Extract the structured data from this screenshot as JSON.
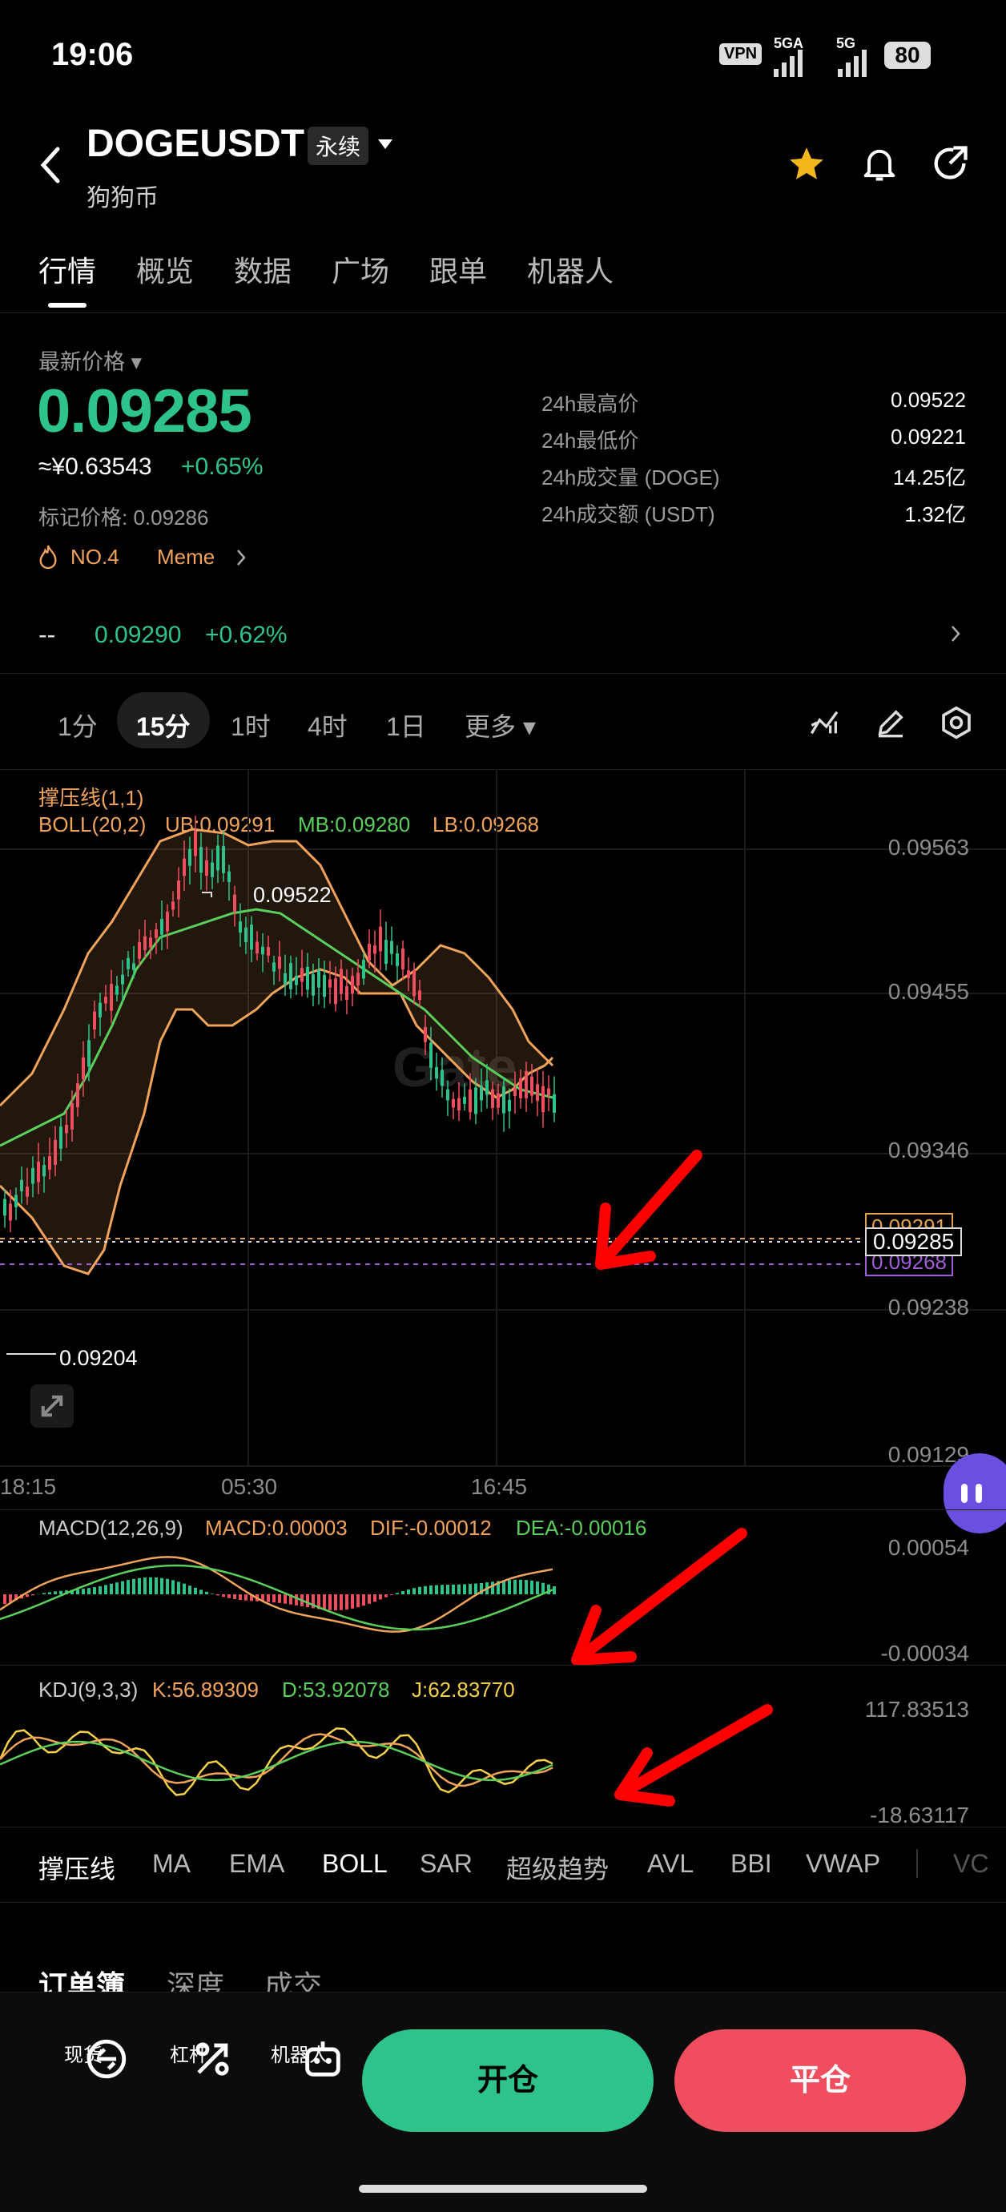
{
  "status": {
    "time": "19:06",
    "vpn": "VPN",
    "signal1": "5GA",
    "signal2": "5G",
    "battery": "80"
  },
  "header": {
    "symbol": "DOGEUSDT",
    "contract_type": "永续",
    "subtitle": "狗狗币"
  },
  "tabs": [
    "行情",
    "概览",
    "数据",
    "广场",
    "跟单",
    "机器人"
  ],
  "price": {
    "label": "最新价格",
    "last": "0.09285",
    "cny": "≈¥0.63543",
    "change": "+0.65%",
    "mark": "标记价格: 0.09286",
    "rank": "NO.4",
    "tag": "Meme"
  },
  "stats": [
    {
      "label": "24h最高价",
      "value": "0.09522"
    },
    {
      "label": "24h最低价",
      "value": "0.09221"
    },
    {
      "label": "24h成交量 (DOGE)",
      "value": "14.25亿"
    },
    {
      "label": "24h成交额 (USDT)",
      "value": "1.32亿"
    }
  ],
  "sub_row": {
    "dash": "--",
    "price": "0.09290",
    "change": "+0.62%"
  },
  "intervals": [
    "1分",
    "15分",
    "1时",
    "4时",
    "1日",
    "更多"
  ],
  "chart": {
    "line_indicator": "撑压线(1,1)",
    "boll_label": "BOLL(20,2)",
    "ub": "UB:0.09291",
    "mb": "MB:0.09280",
    "lb": "LB:0.09268",
    "high_marker": "0.09522",
    "low_marker": "0.09204",
    "y_ticks": [
      "0.09563",
      "0.09455",
      "0.09346",
      "0.09238",
      "0.09129"
    ],
    "x_ticks": [
      "18:15",
      "05:30",
      "16:45"
    ],
    "current_price_tag": "0.09285",
    "ub_tag": "0.09291",
    "lb_tag": "0.09268",
    "watermark": "Gate"
  },
  "macd": {
    "label": "MACD(12,26,9)",
    "macd": "MACD:0.00003",
    "dif": "DIF:-0.00012",
    "dea": "DEA:-0.00016",
    "top": "0.00054",
    "bottom": "-0.00034"
  },
  "kdj": {
    "label": "KDJ(9,3,3)",
    "k": "K:56.89309",
    "d": "D:53.92078",
    "j": "J:62.83770",
    "top": "117.83513",
    "bottom": "-18.63117"
  },
  "indicators": [
    "撑压线",
    "MA",
    "EMA",
    "BOLL",
    "SAR",
    "超级趋势",
    "AVL",
    "BBI",
    "VWAP",
    "VC"
  ],
  "bottom_tabs": [
    "订单簿",
    "深度",
    "成交"
  ],
  "bottom_nav": [
    {
      "label": "现货",
      "icon": "spot-icon"
    },
    {
      "label": "杠杆",
      "icon": "leverage-icon"
    },
    {
      "label": "机器人",
      "icon": "robot-icon"
    }
  ],
  "actions": {
    "open": "开仓",
    "close": "平仓"
  },
  "colors": {
    "green": "#2ec38a",
    "red": "#f04e5e",
    "orange": "#f0a35a",
    "bg": "#000000"
  }
}
